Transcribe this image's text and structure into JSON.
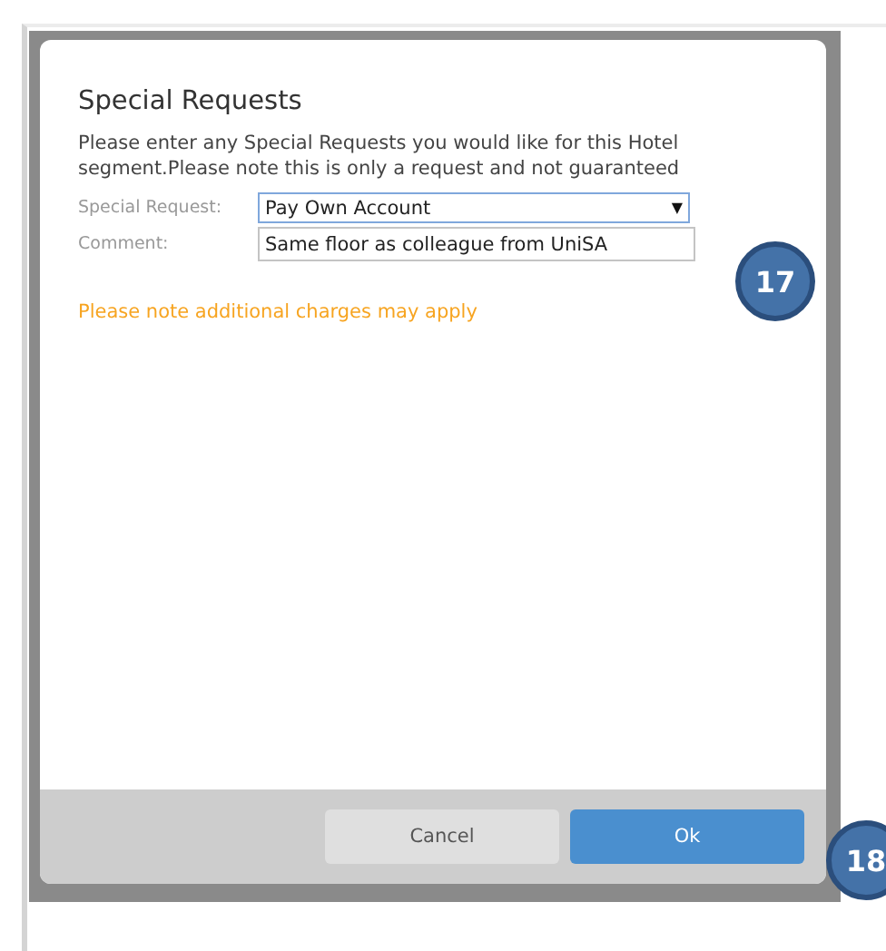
{
  "dialog": {
    "title": "Special Requests",
    "description": "Please enter any Special Requests you would like for this Hotel segment.Please note this is only a request and not guaranteed",
    "fields": [
      {
        "kind": "select",
        "label": "Special Request:",
        "value": "Pay Own Account",
        "caret": "▼"
      },
      {
        "kind": "text",
        "label": "Comment:",
        "value": "Same floor as colleague from UniSA"
      }
    ],
    "notice": "Please note additional charges may apply",
    "buttons": [
      {
        "label": "Cancel",
        "kind": "secondary"
      },
      {
        "label": "Ok",
        "kind": "primary"
      }
    ]
  },
  "callouts": [
    "17",
    "18"
  ]
}
